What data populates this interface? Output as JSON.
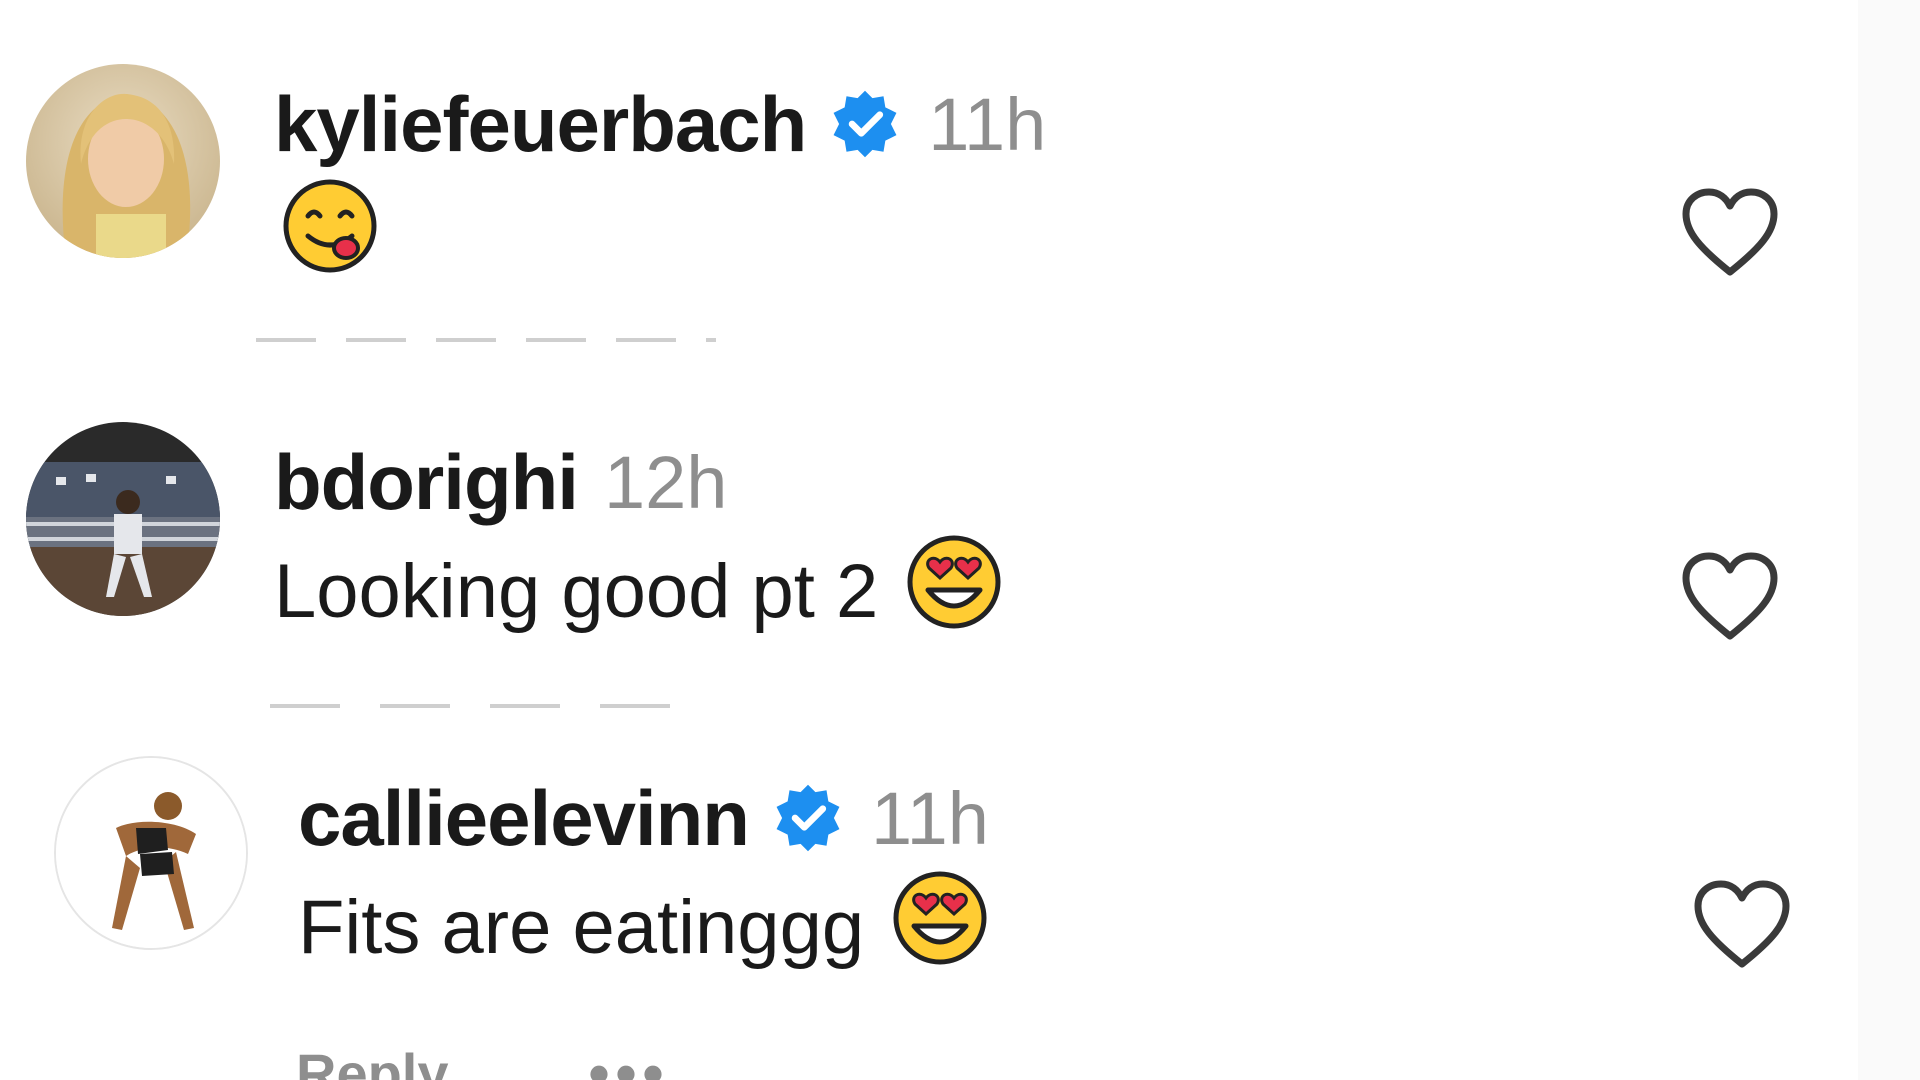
{
  "comments": [
    {
      "username": "kyliefeuerbach",
      "verified": true,
      "time": "11h",
      "text": "",
      "emoji": "tongue-yum-emoji",
      "avatar": "blonde-woman-avatar"
    },
    {
      "username": "bdorighi",
      "verified": false,
      "time": "12h",
      "text": "Looking good pt 2",
      "emoji": "heart-eyes-emoji",
      "avatar": "baseball-player-avatar"
    },
    {
      "username": "callieelevinn",
      "verified": true,
      "time": "11h",
      "text": "Fits are eatinggg",
      "emoji": "heart-eyes-emoji",
      "avatar": "posing-woman-avatar",
      "reply_label": "Reply",
      "more_label": "•••"
    }
  ],
  "colors": {
    "username": "#1a1a1a",
    "timestamp": "#8e8e8e",
    "verified_badge": "#1d8ff0",
    "like_icon": "#3a3a3a"
  }
}
